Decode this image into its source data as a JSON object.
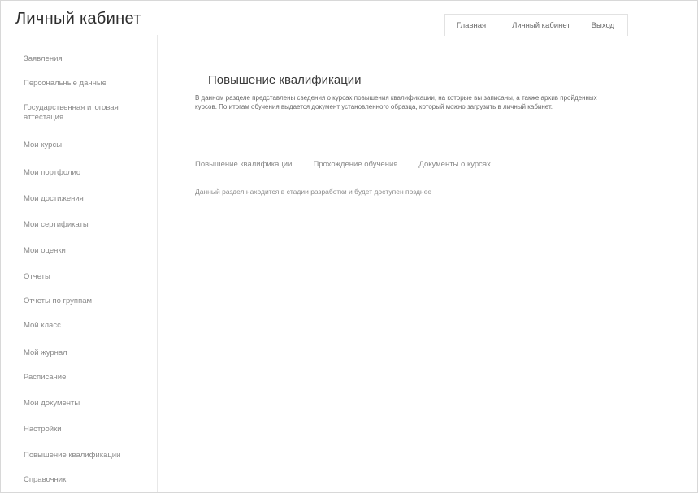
{
  "header": {
    "title": "Личный кабинет",
    "nav": {
      "main": "Главная",
      "cabinet": "Личный кабинет",
      "logout": "Выход"
    }
  },
  "sidebar": {
    "items": [
      {
        "label": "Заявления"
      },
      {
        "label": "Персональные данные"
      },
      {
        "label": "Государственная итоговая аттестация"
      },
      {
        "label": "Мои курсы"
      },
      {
        "label": "Мои портфолио"
      },
      {
        "label": "Мои достижения"
      },
      {
        "label": "Мои сертификаты"
      },
      {
        "label": "Мои оценки"
      },
      {
        "label": "Отчеты"
      },
      {
        "label": "Отчеты по группам"
      },
      {
        "label": "Мой класс"
      },
      {
        "label": "Мой журнал"
      },
      {
        "label": "Расписание"
      },
      {
        "label": "Мои документы"
      },
      {
        "label": "Настройки"
      },
      {
        "label": "Повышение квалификации"
      },
      {
        "label": "Справочник"
      }
    ]
  },
  "main": {
    "title": "Повышение квалификации",
    "description": "В данном разделе представлены сведения о курсах повышения квалификации, на которые вы записаны, а также архив пройденных курсов. По итогам обучения выдается документ установленного образца, который можно загрузить в личный кабинет.",
    "tabs": [
      {
        "label": "Повышение квалификации"
      },
      {
        "label": "Прохождение обучения"
      },
      {
        "label": "Документы о курсах"
      }
    ],
    "tab_note": "Данный раздел находится в стадии разработки и будет доступен позднее"
  }
}
